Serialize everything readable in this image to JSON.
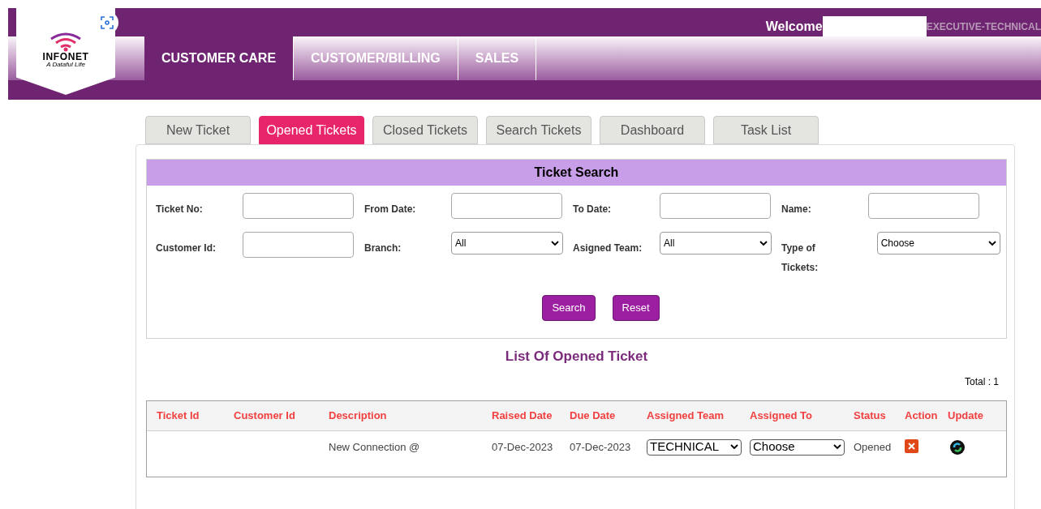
{
  "header": {
    "logo": {
      "name": "INFONET",
      "tagline": "A Dataful Life"
    },
    "welcome": "Welcome",
    "role": "EXECUTIVE-TECHNICAL"
  },
  "nav": [
    {
      "label": "CUSTOMER CARE",
      "selected": true
    },
    {
      "label": "CUSTOMER/BILLING",
      "selected": false
    },
    {
      "label": "SALES",
      "selected": false
    }
  ],
  "tabs": [
    {
      "label": "New Ticket",
      "selected": false
    },
    {
      "label": "Opened Tickets",
      "selected": true
    },
    {
      "label": "Closed Tickets",
      "selected": false
    },
    {
      "label": "Search Tickets",
      "selected": false
    },
    {
      "label": "Dashboard",
      "selected": false
    },
    {
      "label": "Task List",
      "selected": false
    }
  ],
  "ticket_search": {
    "title": "Ticket Search",
    "rows": [
      [
        {
          "label": "Ticket No:",
          "kind": "input"
        },
        {
          "label": "From Date:",
          "kind": "input"
        },
        {
          "label": "To Date:",
          "kind": "input"
        },
        {
          "label": "Name:",
          "kind": "input"
        }
      ],
      [
        {
          "label": "Customer Id:",
          "kind": "input"
        },
        {
          "label": "Branch:",
          "kind": "select",
          "value": "All"
        },
        {
          "label": "Asigned Team:",
          "kind": "select",
          "value": "All"
        },
        {
          "label": "Type of Tickets:",
          "kind": "select",
          "value": "Choose"
        }
      ]
    ],
    "buttons": [
      "Search",
      "Reset"
    ]
  },
  "list": {
    "title": "List Of Opened Ticket",
    "total": "Total : 1",
    "columns": [
      "Ticket Id",
      "Customer Id",
      "Description",
      "Raised Date",
      "Due Date",
      "Assigned Team",
      "Assigned To",
      "Status",
      "Action",
      "Update"
    ],
    "rows": [
      [
        {
          "kind": "text",
          "text": ""
        },
        {
          "kind": "text",
          "text": ""
        },
        {
          "kind": "text",
          "text": "New Connection @"
        },
        {
          "kind": "text",
          "text": "07-Dec-2023"
        },
        {
          "kind": "text",
          "text": "07-Dec-2023"
        },
        {
          "kind": "select",
          "text": "TECHNICAL"
        },
        {
          "kind": "select",
          "text": "Choose"
        },
        {
          "kind": "text",
          "text": "Opened"
        },
        {
          "kind": "delete"
        },
        {
          "kind": "update"
        }
      ]
    ]
  }
}
